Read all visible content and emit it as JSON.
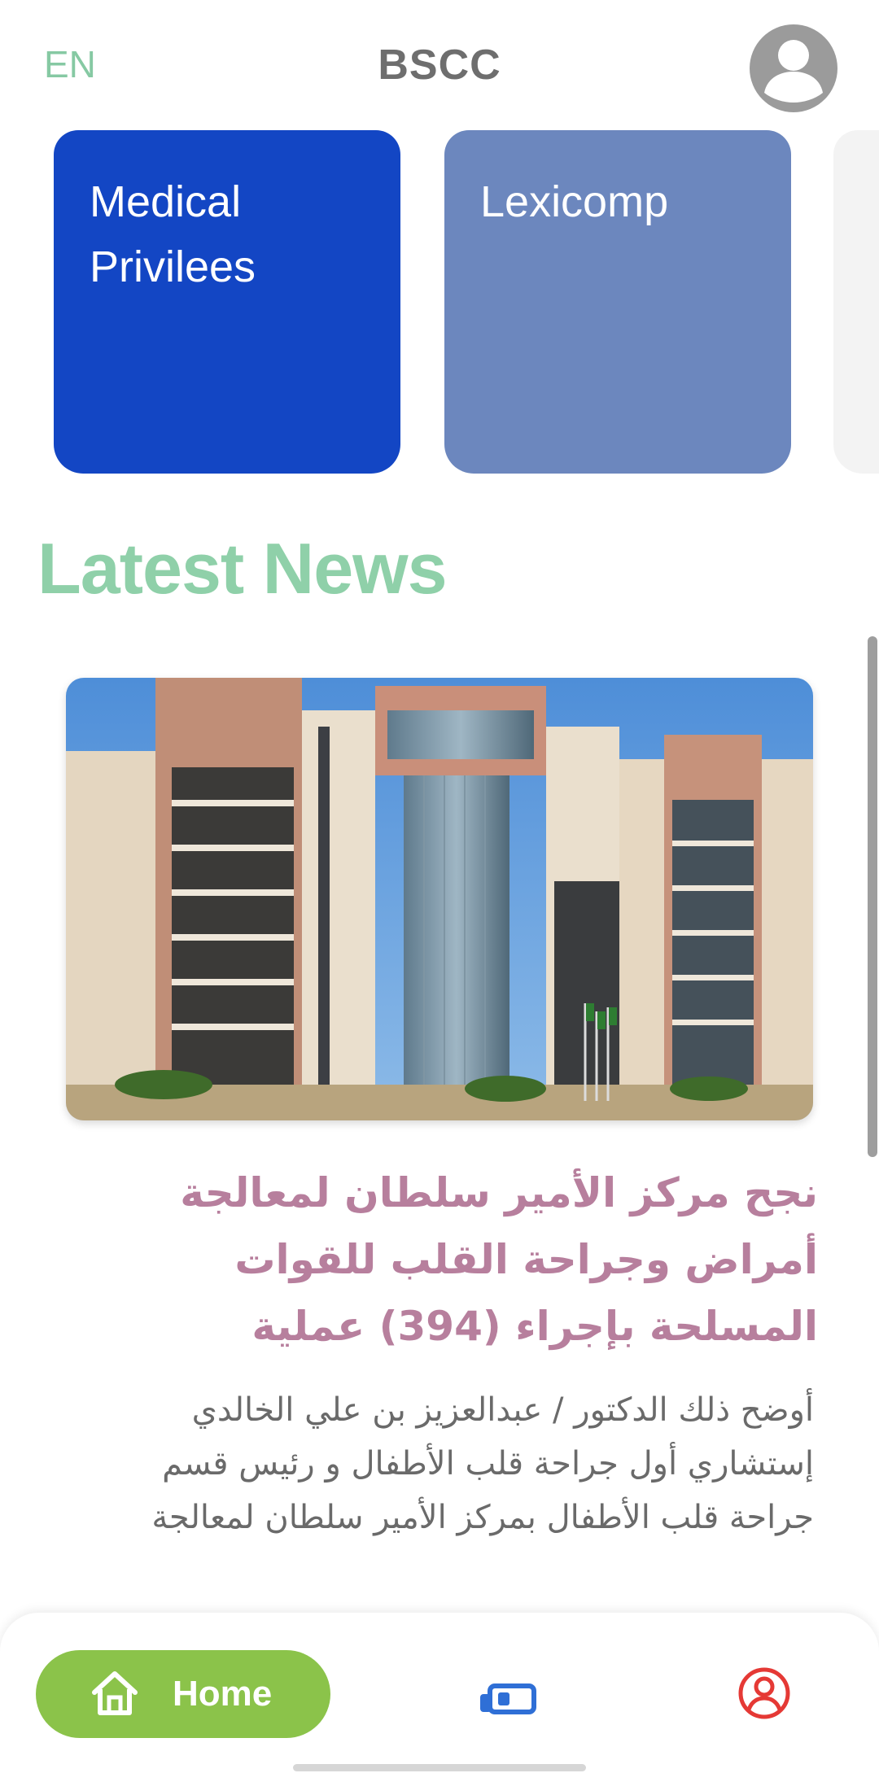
{
  "header": {
    "lang_toggle": "EN",
    "title": "BSCC"
  },
  "tiles": [
    {
      "label": "Medical\nPrivilees"
    },
    {
      "label": "Lexicomp"
    }
  ],
  "section_title": "Latest News",
  "news": {
    "headline": "نجح مركز الأمير سلطان لمعالجة أمراض وجراحة القلب للقوات المسلحة بإجراء (394) عملية",
    "body": "أوضح ذلك الدكتور / عبدالعزيز بن علي الخالدي إستشاري أول جراحة قلب الأطفال و رئيس قسم جراحة قلب الأطفال بمركز الأمير سلطان لمعالجة"
  },
  "bottom_nav": {
    "home_label": "Home",
    "icons": [
      "home-icon",
      "news-icon",
      "profile-icon"
    ]
  },
  "colors": {
    "accent_green": "#8bc34a",
    "title_green": "#8fd0a9",
    "tile_blue": "#1346c4",
    "tile_slate": "#6c87be",
    "headline_mauve": "#b77f9d",
    "profile_red": "#e53935",
    "news_icon_blue": "#2f6fd6"
  }
}
